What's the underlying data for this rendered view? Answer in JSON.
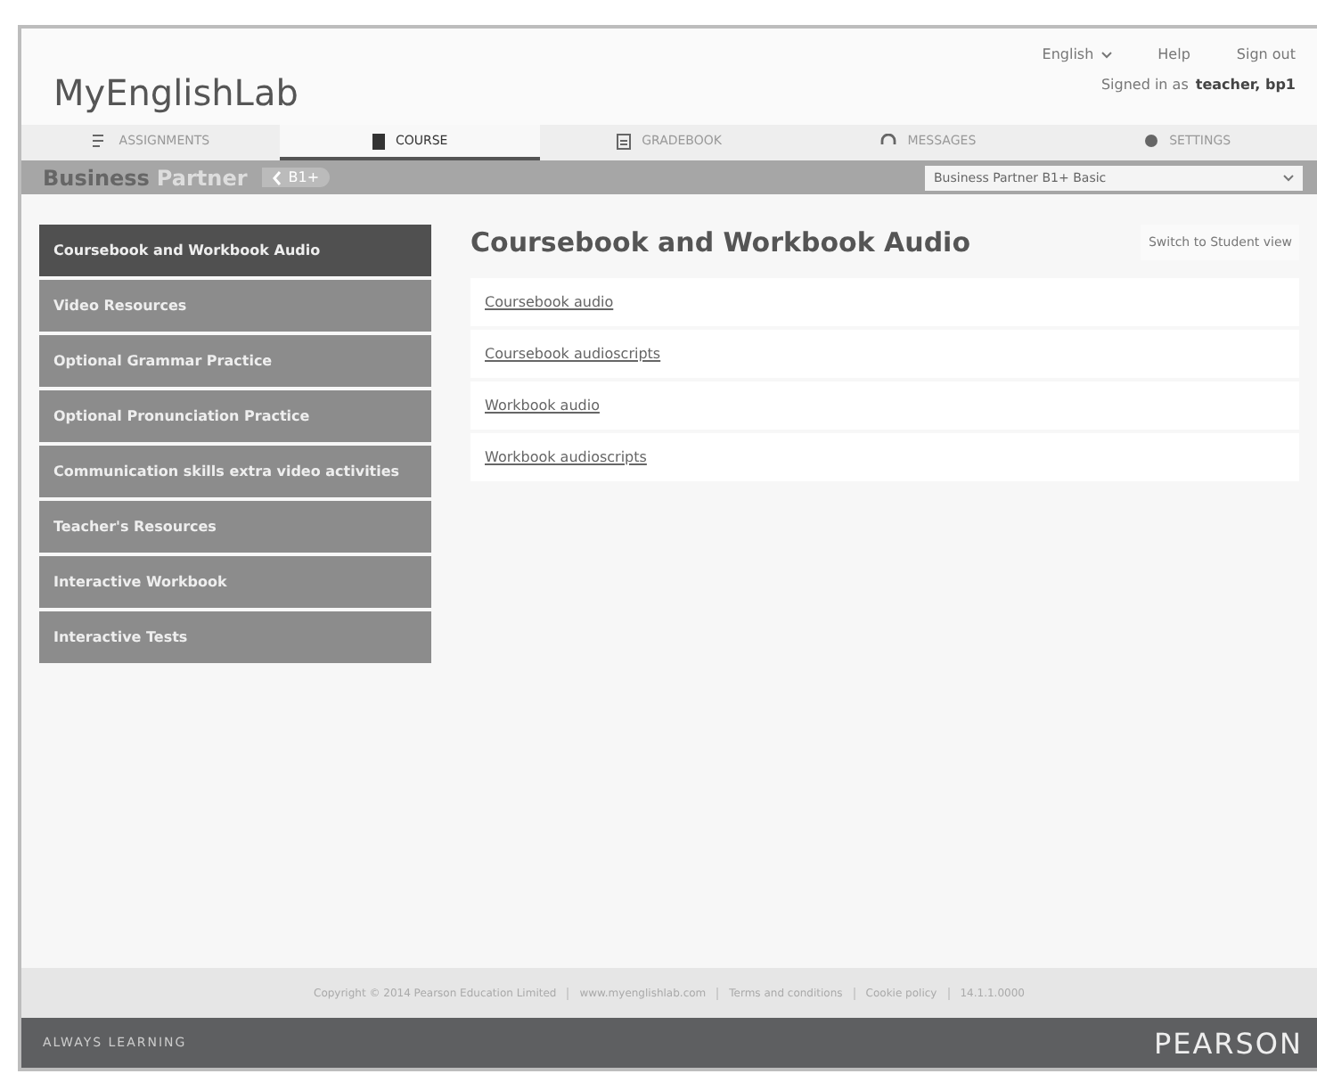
{
  "header": {
    "logo": "MyEnglishLab",
    "language": "English",
    "help": "Help",
    "sign_out": "Sign out",
    "signed_in_label": "Signed in as",
    "user": "teacher, bp1"
  },
  "tabs": [
    {
      "label": "ASSIGNMENTS",
      "selected": false
    },
    {
      "label": "COURSE",
      "selected": true
    },
    {
      "label": "GRADEBOOK",
      "selected": false
    },
    {
      "label": "MESSAGES",
      "selected": false
    },
    {
      "label": "SETTINGS",
      "selected": false
    }
  ],
  "course_bar": {
    "brand_first": "Business",
    "brand_second": "Partner",
    "level": "B1+",
    "course_select": "Business Partner B1+ Basic"
  },
  "sidebar": {
    "items": [
      {
        "label": "Coursebook and Workbook Audio",
        "selected": true
      },
      {
        "label": "Video Resources",
        "selected": false
      },
      {
        "label": "Optional Grammar Practice",
        "selected": false
      },
      {
        "label": "Optional Pronunciation Practice",
        "selected": false
      },
      {
        "label": "Communication skills extra video activities",
        "selected": false
      },
      {
        "label": "Teacher's Resources",
        "selected": false
      },
      {
        "label": "Interactive Workbook",
        "selected": false
      },
      {
        "label": "Interactive Tests",
        "selected": false
      }
    ]
  },
  "content": {
    "title": "Coursebook and Workbook Audio",
    "switch_button": "Switch to Student view",
    "links": [
      "Coursebook audio",
      "Coursebook audioscripts",
      "Workbook audio",
      "Workbook audioscripts"
    ]
  },
  "footer": {
    "links": [
      "Copyright © 2014 Pearson Education Limited",
      "www.myenglishlab.com",
      "Terms and conditions",
      "Cookie policy",
      "14.1.1.0000"
    ],
    "tagline": "ALWAYS LEARNING",
    "brand": "PEARSON"
  }
}
